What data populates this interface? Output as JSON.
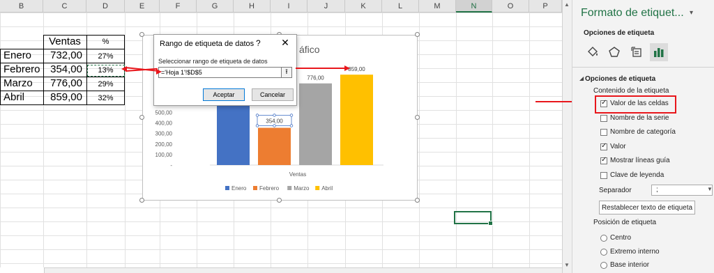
{
  "sheet": {
    "columns": [
      "B",
      "C",
      "D",
      "E",
      "F",
      "G",
      "H",
      "I",
      "J",
      "K",
      "L",
      "M",
      "N",
      "O",
      "P"
    ],
    "selected_column": "N",
    "table": {
      "header": {
        "sales": "Ventas",
        "percent": "%"
      },
      "rows": [
        {
          "month": "Enero",
          "sales": "732,00",
          "percent": "27%"
        },
        {
          "month": "Febrero",
          "sales": "354,00",
          "percent": "13%"
        },
        {
          "month": "Marzo",
          "sales": "776,00",
          "percent": "29%"
        },
        {
          "month": "Abril",
          "sales": "859,00",
          "percent": "32%"
        }
      ]
    }
  },
  "chart": {
    "title_visible": "áfico",
    "selected_label": "354,00",
    "colors": {
      "Enero": "#4472c4",
      "Febrero": "#ed7d31",
      "Marzo": "#a5a5a5",
      "Abril": "#ffc000"
    }
  },
  "chart_data": {
    "type": "bar",
    "categories": [
      "Ventas"
    ],
    "series": [
      {
        "name": "Enero",
        "values": [
          732
        ]
      },
      {
        "name": "Febrero",
        "values": [
          354
        ]
      },
      {
        "name": "Marzo",
        "values": [
          776
        ]
      },
      {
        "name": "Abril",
        "values": [
          859
        ]
      }
    ],
    "data_labels": [
      "",
      "354,00",
      "776,00",
      "859,00"
    ],
    "yticks": [
      "-",
      "100,00",
      "200,00",
      "300,00",
      "400,00",
      "500,00"
    ],
    "ylim": [
      0,
      900
    ],
    "xlabel": "Ventas",
    "legend": "bottom"
  },
  "dialog": {
    "title": "Rango de etiqueta de datos",
    "help": "?",
    "close": "✕",
    "field_label": "Seleccionar rango de etiqueta de datos",
    "field_value": "='Hoja 1'!$D$5",
    "ok": "Aceptar",
    "cancel": "Cancelar"
  },
  "pane": {
    "title": "Formato de etiquet...",
    "subtitle": "Opciones de etiqueta",
    "section": "Opciones de etiqueta",
    "content_heading": "Contenido de la etiqueta",
    "options": [
      {
        "label": "Valor de las celdas",
        "checked": true
      },
      {
        "label": "Nombre de la serie",
        "checked": false
      },
      {
        "label": "Nombre de categoría",
        "checked": false
      },
      {
        "label": "Valor",
        "checked": true
      },
      {
        "label": "Mostrar líneas guía",
        "checked": true
      },
      {
        "label": "Clave de leyenda",
        "checked": false
      }
    ],
    "separator_label": "Separador",
    "separator_value": ";",
    "reset_button": "Restablecer texto de etiqueta",
    "position_heading": "Posición de etiqueta",
    "positions": [
      "Centro",
      "Extremo interno",
      "Base interior"
    ]
  },
  "icons": {
    "fill": "paint-bucket-icon",
    "effects": "pentagon-icon",
    "size": "size-properties-icon",
    "label_options": "bar-chart-icon"
  }
}
